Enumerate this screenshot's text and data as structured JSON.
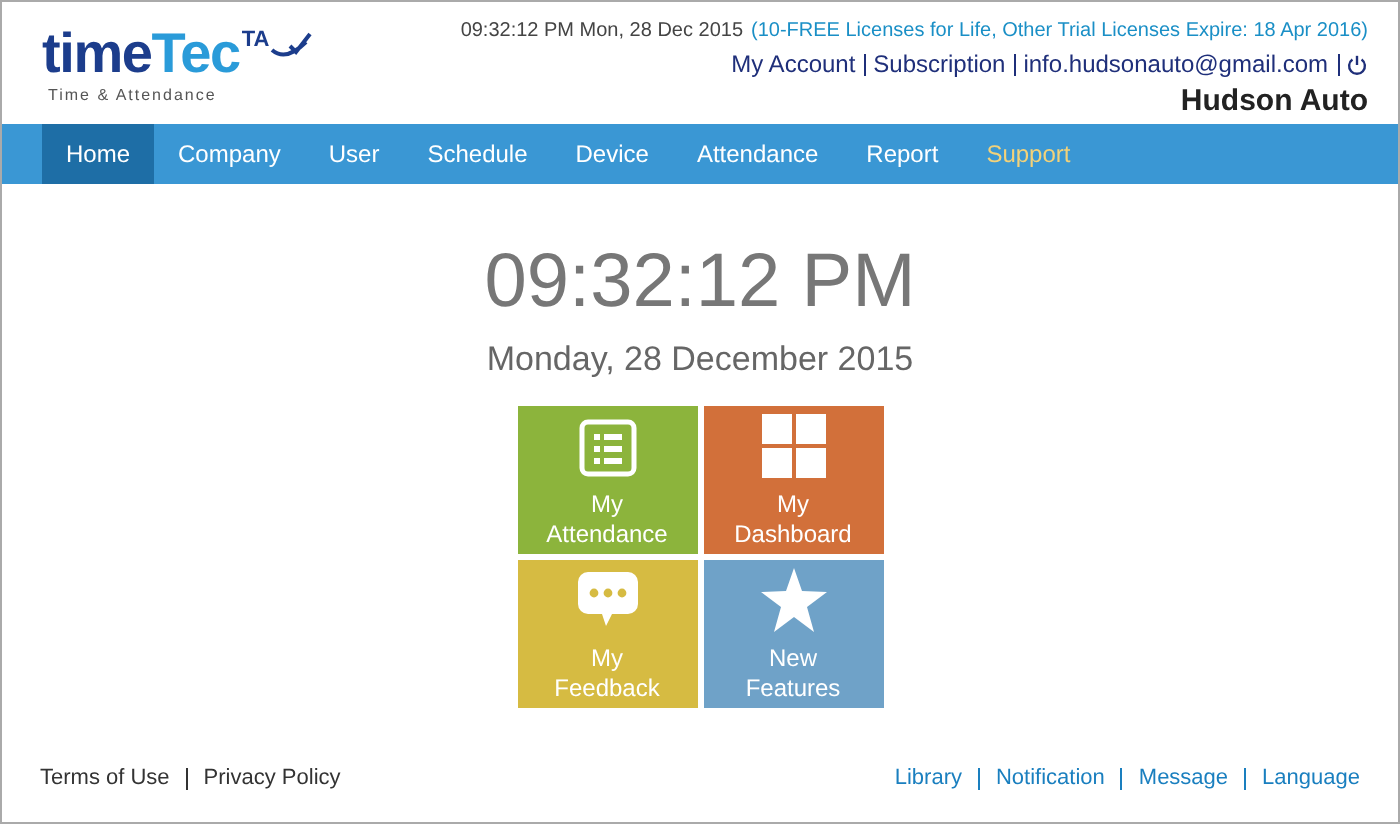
{
  "logo": {
    "word_dark": "time",
    "word_light": "Tec",
    "badge": "TA",
    "tagline": "Time & Attendance"
  },
  "header": {
    "timestamp": "09:32:12 PM Mon, 28 Dec 2015",
    "license_notice": "(10-FREE Licenses for Life, Other Trial Licenses Expire: 18 Apr 2016)",
    "account_links": [
      "My Account",
      "Subscription",
      "info.hudsonauto@gmail.com"
    ],
    "company": "Hudson Auto"
  },
  "nav": [
    {
      "label": "Home",
      "selected": true,
      "highlighted": false
    },
    {
      "label": "Company",
      "selected": false,
      "highlighted": false
    },
    {
      "label": "User",
      "selected": false,
      "highlighted": false
    },
    {
      "label": "Schedule",
      "selected": false,
      "highlighted": false
    },
    {
      "label": "Device",
      "selected": false,
      "highlighted": false
    },
    {
      "label": "Attendance",
      "selected": false,
      "highlighted": false
    },
    {
      "label": "Report",
      "selected": false,
      "highlighted": false
    },
    {
      "label": "Support",
      "selected": false,
      "highlighted": true
    }
  ],
  "clock": {
    "time": "09:32:12 PM",
    "date": "Monday, 28 December 2015"
  },
  "tiles": [
    {
      "kind": "list",
      "line1": "My",
      "line2": "Attendance",
      "color": "#8cb43c"
    },
    {
      "kind": "grid",
      "line1": "My",
      "line2": "Dashboard",
      "color": "#d2703a"
    },
    {
      "kind": "chat",
      "line1": "My",
      "line2": "Feedback",
      "color": "#d6bb42"
    },
    {
      "kind": "star",
      "line1": "New",
      "line2": "Features",
      "color": "#6fa2c8"
    }
  ],
  "footer": {
    "left_links": [
      "Terms of Use",
      "Privacy Policy"
    ],
    "right_links": [
      "Library",
      "Notification",
      "Message",
      "Language"
    ]
  }
}
